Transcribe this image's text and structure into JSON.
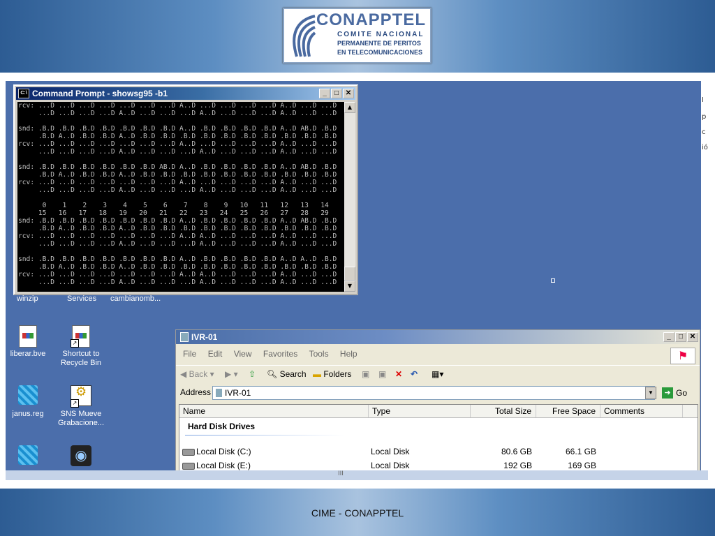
{
  "slide": {
    "logo": {
      "name": "CONAPPTEL",
      "line1": "COMITE NACIONAL",
      "line2": "PERMANENTE DE PERITOS",
      "line3": "EN TELECOMUNICACIONES"
    },
    "footer": "CIME - CONAPPTEL"
  },
  "cmd": {
    "title": "Command Prompt - showsg95 -b1",
    "lines": [
      "rcv: ...D ...D ...D ...D ...D ...D ...D A..D ...D ...D ...D ...D A..D ...D ...D",
      "     ...D ...D ...D ...D A..D ...D ...D ...D A..D ...D ...D ...D A..D ...D ...D",
      "",
      "snd: .B.D .B.D .B.D .B.D .B.D .B.D .B.D A..D .B.D .B.D .B.D .B.D A..D AB.D .B.D",
      "     .B.D A..D .B.D .B.D A..D .B.D .B.D .B.D .B.D .B.D .B.D .B.D .B.D .B.D .B.D",
      "rcv: ...D ...D ...D ...D ...D ...D ...D A..D ...D ...D ...D ...D A..D ...D ...D",
      "     ...D ...D ...D ...D A..D ...D ...D ...D A..D ...D ...D ...D A..D ...D ...D",
      "",
      "snd: .B.D .B.D .B.D .B.D .B.D .B.D AB.D A..D .B.D .B.D .B.D .B.D A..D AB.D .B.D",
      "     .B.D A..D .B.D .B.D A..D .B.D .B.D .B.D .B.D .B.D .B.D .B.D .B.D .B.D .B.D",
      "rcv: ...D ...D ...D ...D ...D ...D ...D A..D ...D ...D ...D ...D A..D ...D ...D",
      "     ...D ...D ...D ...D A..D ...D ...D ...D A..D ...D ...D ...D A..D ...D ...D",
      "",
      "      0    1    2    3    4    5    6    7    8    9   10   11   12   13   14",
      "     15   16   17   18   19   20   21   22   23   24   25   26   27   28   29",
      "snd: .B.D .B.D .B.D .B.D .B.D .B.D .B.D A..D .B.D .B.D .B.D .B.D A..D AB.D .B.D",
      "     .B.D A..D .B.D .B.D A..D .B.D .B.D .B.D .B.D .B.D .B.D .B.D .B.D .B.D .B.D",
      "rcv: ...D ...D ...D ...D ...D ...D ...D A..D A..D ...D ...D ...D A..D ...D ...D",
      "     ...D ...D ...D ...D A..D ...D ...D ...D A..D ...D ...D ...D A..D ...D ...D",
      "",
      "snd: .B.D .B.D .B.D .B.D .B.D .B.D .B.D A..D .B.D .B.D .B.D .B.D A..D A..D .B.D",
      "     .B.D A..D .B.D .B.D A..D .B.D .B.D .B.D .B.D .B.D .B.D .B.D .B.D .B.D .B.D",
      "rcv: ...D ...D ...D ...D ...D ...D ...D A..D A..D ...D ...D ...D A..D ...D ...D",
      "     ...D ...D ...D ...D A..D ...D ...D ...D A..D ...D ...D ...D A..D ...D ...D",
      "_"
    ]
  },
  "desktop": {
    "partial_labels": [
      "winzip",
      "Services",
      "cambianomb..."
    ],
    "icons": [
      {
        "label1": "liberar.bve",
        "label2": ""
      },
      {
        "label1": "Shortcut to",
        "label2": "Recycle Bin"
      },
      {
        "label1": "janus.reg",
        "label2": ""
      },
      {
        "label1": "SNS Mueve",
        "label2": "Grabacione..."
      }
    ]
  },
  "explorer": {
    "title": "IVR-01",
    "menu": [
      "File",
      "Edit",
      "View",
      "Favorites",
      "Tools",
      "Help"
    ],
    "toolbar": {
      "back": "Back",
      "search": "Search",
      "folders": "Folders"
    },
    "address_label": "Address",
    "address_value": "IVR-01",
    "go": "Go",
    "columns": [
      "Name",
      "Type",
      "Total Size",
      "Free Space",
      "Comments"
    ],
    "group": "Hard Disk Drives",
    "rows": [
      {
        "name": "Local Disk (C:)",
        "type": "Local Disk",
        "total": "80.6 GB",
        "free": "66.1 GB"
      },
      {
        "name": "Local Disk (E:)",
        "type": "Local Disk",
        "total": "192 GB",
        "free": "169 GB"
      }
    ]
  }
}
